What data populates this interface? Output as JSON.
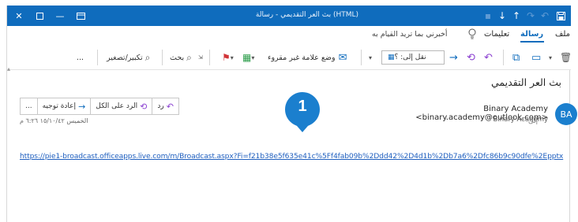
{
  "titlebar": {
    "title": "بث العر التقديمي - رسالة (HTML)",
    "left_icons": [
      "close-icon",
      "restore-icon",
      "minimize-icon",
      "ribbon-display-icon"
    ],
    "qat_icons": [
      "save-icon",
      "undo-icon",
      "redo-icon",
      "up-arrow-icon",
      "down-arrow-icon",
      "customize-icon"
    ]
  },
  "tabs": {
    "file": "ملف",
    "message": "رسالة",
    "help": "تعليمات",
    "tell_me": "أخبرني بما تريد القيام به"
  },
  "ribbon": {
    "move_to": "نقل إلى: ؟",
    "mark_unread": "وضع علامة غير مقروء",
    "search": "بحث",
    "zoom": "تكبير/تصغير",
    "more": "..."
  },
  "message": {
    "subject": "بث العر التقديمي",
    "sender": "Binary Academy <binary.academy@outlook.com>",
    "to_label": "إلى",
    "to_name": "Binary Academy",
    "avatar_initials": "BA",
    "date": "الخميس ١٥/١٠/٤٢ ٦:٢٦ م",
    "link": "https://pie1-broadcast.officeapps.live.com/m/Broadcast.aspx?Fi=f21b38e5f635e41c%5Ff4fab09b%2Ddd42%2D4d1b%2Db7a6%2Dfc86b9c90dfe%2Epptx"
  },
  "actions": {
    "reply": "رد",
    "reply_all": "الرد على الكل",
    "forward": "إعادة توجيه",
    "more": "..."
  },
  "callout": {
    "number": "1",
    "color": "#1b7fce"
  },
  "colors": {
    "accent": "#0f6cbd",
    "link": "#1f5fbf"
  }
}
